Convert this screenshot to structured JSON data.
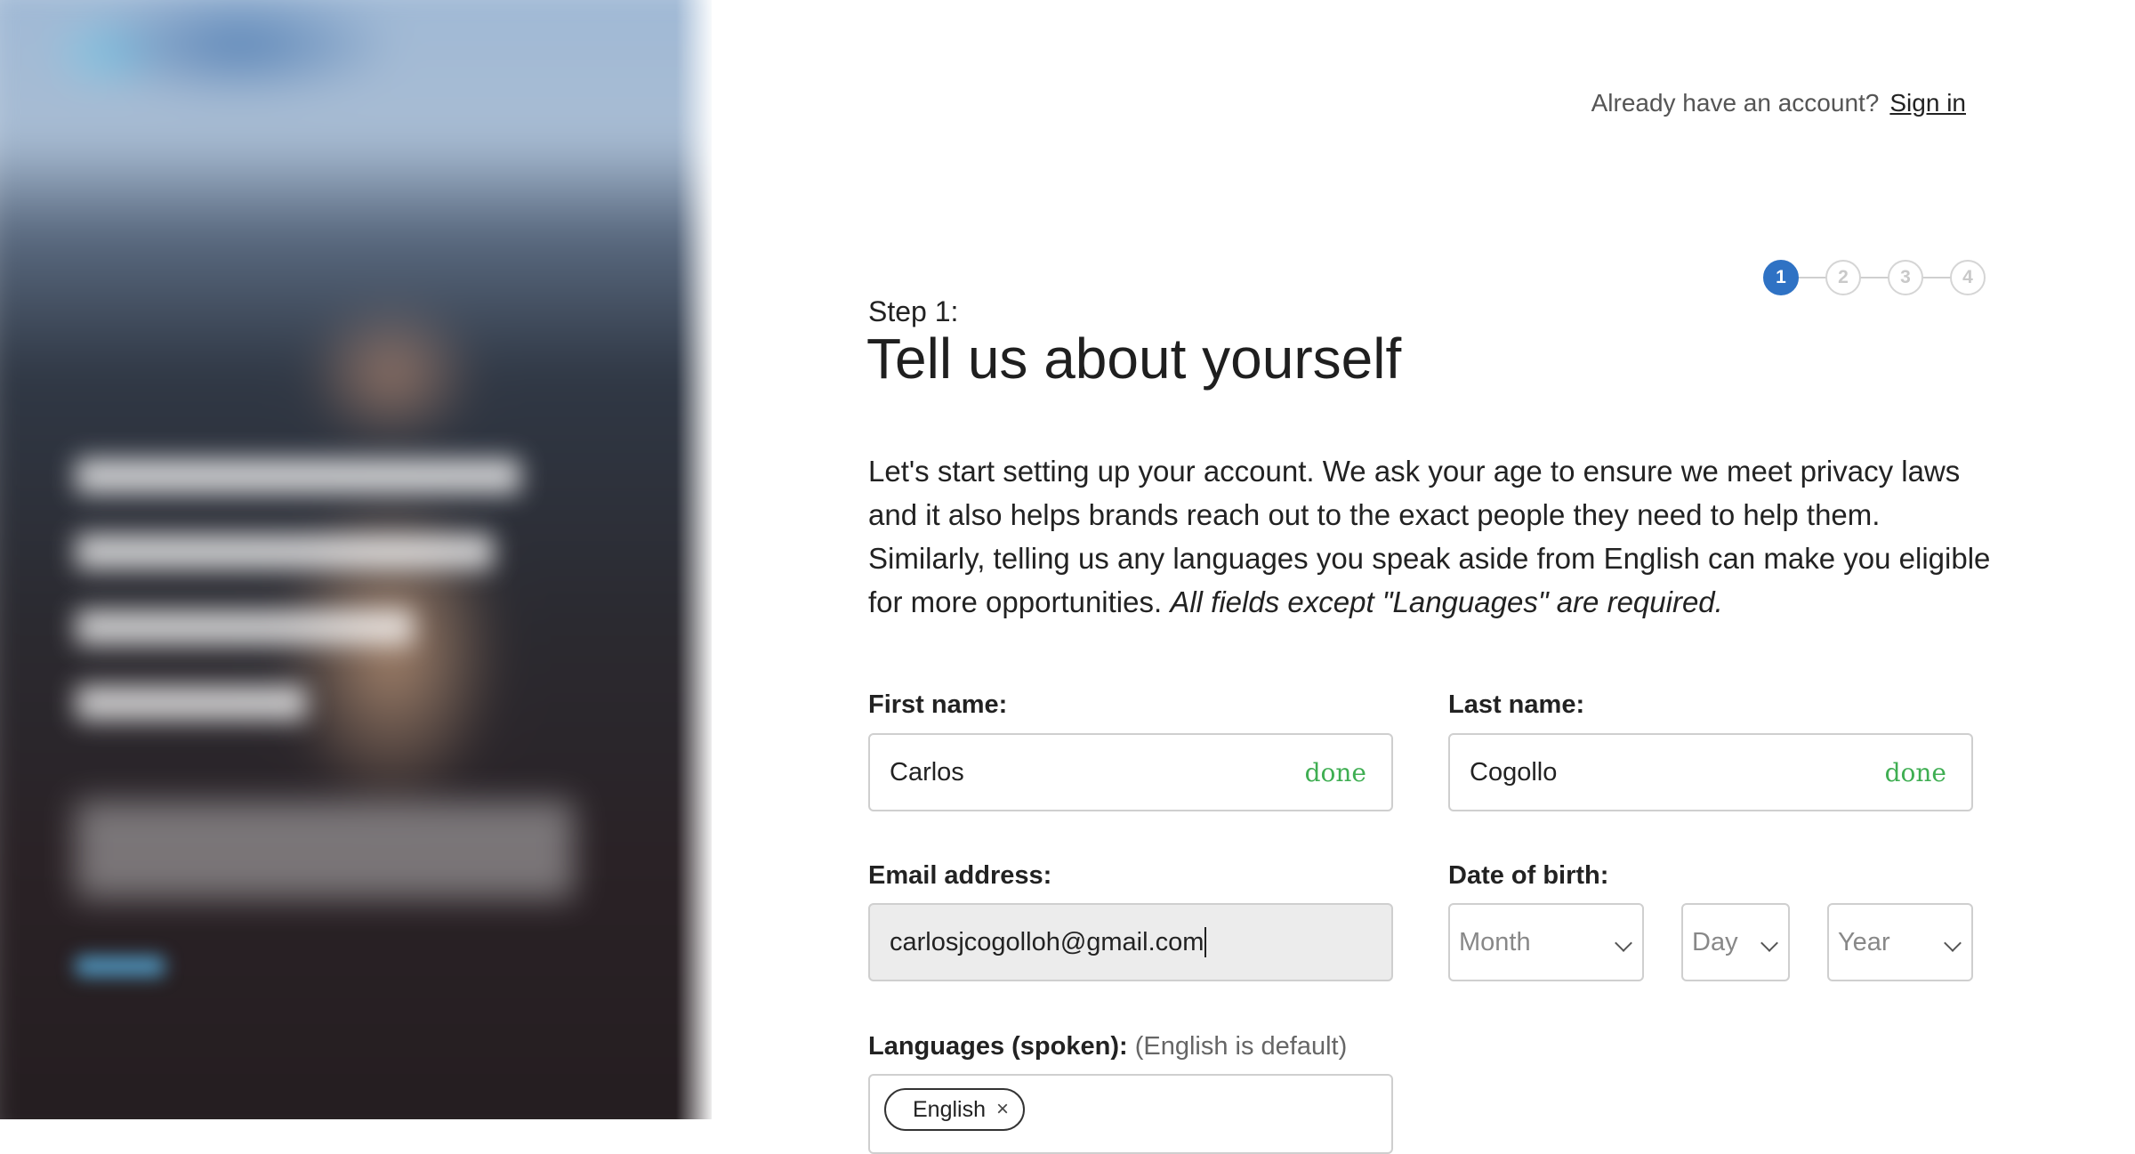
{
  "header": {
    "prompt": "Already have an account?",
    "signin_link": "Sign in"
  },
  "stepper": {
    "steps": [
      "1",
      "2",
      "3",
      "4"
    ],
    "current": 1
  },
  "step_label": "Step 1:",
  "title": "Tell us about yourself",
  "intro": {
    "text": "Let's start setting up your account. We ask your age to ensure we meet privacy laws and it also helps brands reach out to the exact people they need to help them. Similarly, telling us any languages you speak aside from English can make you eligible for more opportunities. ",
    "emphasis": "All fields except \"Languages\" are required."
  },
  "form": {
    "first_name": {
      "label": "First name:",
      "value": "Carlos",
      "status": "done"
    },
    "last_name": {
      "label": "Last name:",
      "value": "Cogollo",
      "status": "done"
    },
    "email": {
      "label": "Email address:",
      "value": "carlosjcogolloh@gmail.com"
    },
    "dob": {
      "label": "Date of birth:",
      "month_placeholder": "Month",
      "day_placeholder": "Day",
      "year_placeholder": "Year"
    },
    "languages": {
      "label": "Languages (spoken):",
      "hint": "(English is default)",
      "chips": [
        "English"
      ],
      "remove_glyph": "×"
    }
  },
  "colors": {
    "accent": "#2f72c4",
    "done": "#3fae52"
  }
}
